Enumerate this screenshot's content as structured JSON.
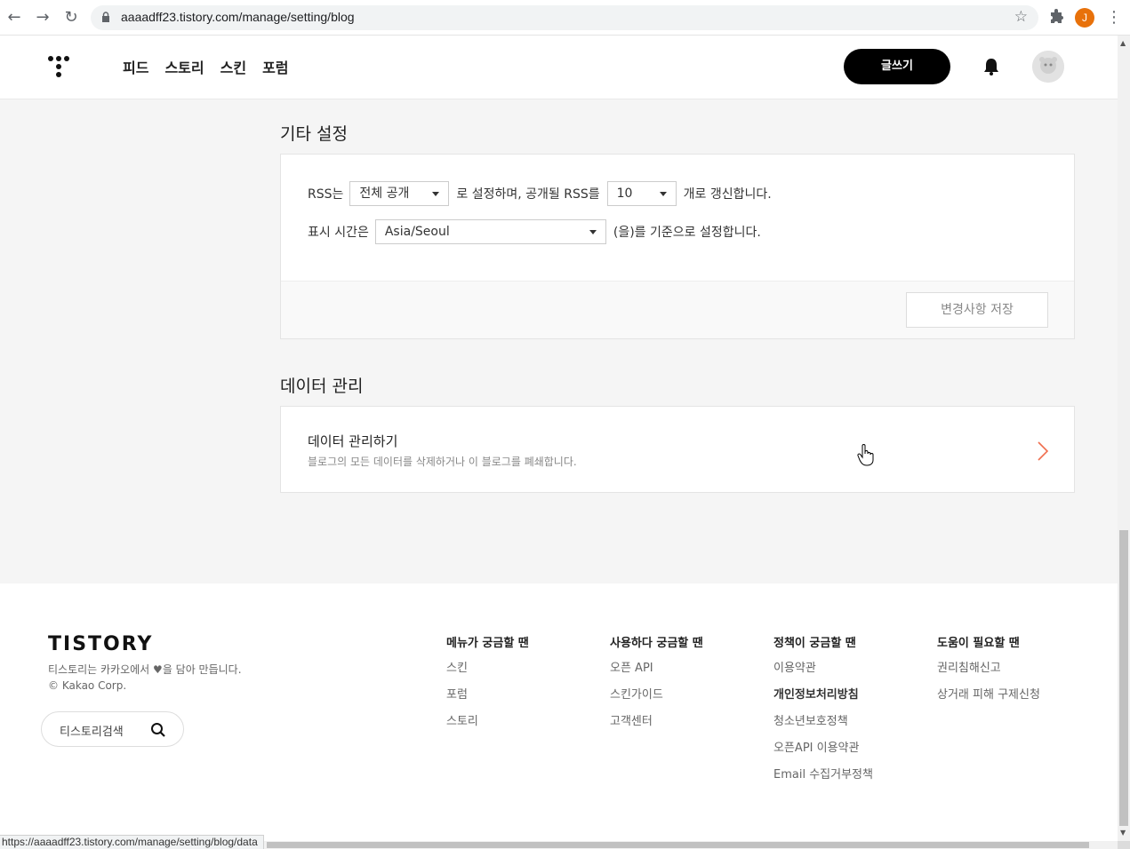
{
  "browser": {
    "url": "aaaadff23.tistory.com/manage/setting/blog",
    "profile_initial": "J",
    "status_url": "https://aaaadff23.tistory.com/manage/setting/blog/data"
  },
  "header": {
    "nav": [
      "피드",
      "스토리",
      "스킨",
      "포럼"
    ],
    "write_label": "글쓰기"
  },
  "misc_settings": {
    "title": "기타 설정",
    "rss_prefix": "RSS는",
    "rss_visibility": "전체 공개",
    "rss_middle": "로 설정하며, 공개될 RSS를",
    "rss_count": "10",
    "rss_suffix": "개로 갱신합니다.",
    "time_prefix": "표시 시간은",
    "timezone": "Asia/Seoul",
    "time_suffix": "(을)를 기준으로 설정합니다.",
    "save_label": "변경사항 저장"
  },
  "data_management": {
    "title": "데이터 관리",
    "item_title": "데이터 관리하기",
    "item_desc": "블로그의 모든 데이터를 삭제하거나 이 블로그를 폐쇄합니다."
  },
  "footer": {
    "logo": "TISTORY",
    "desc_before": "티스토리는 카카오에서",
    "desc_after": "을 담아 만듭니다.",
    "copyright": "© Kakao Corp.",
    "search_placeholder": "티스토리검색",
    "columns": [
      {
        "title": "메뉴가 궁금할 땐",
        "items": [
          "스킨",
          "포럼",
          "스토리"
        ]
      },
      {
        "title": "사용하다 궁금할 땐",
        "items": [
          "오픈 API",
          "스킨가이드",
          "고객센터"
        ]
      },
      {
        "title": "정책이 궁금할 땐",
        "items": [
          "이용약관",
          "개인정보처리방침",
          "청소년보호정책",
          "오픈API 이용약관",
          "Email 수집거부정책"
        ]
      },
      {
        "title": "도움이 필요할 땐",
        "items": [
          "권리침해신고",
          "상거래 피해 구제신청"
        ]
      }
    ]
  },
  "colors": {
    "accent_chevron": "#f06e4e",
    "write_button": "#000000",
    "profile": "#e8710a"
  }
}
